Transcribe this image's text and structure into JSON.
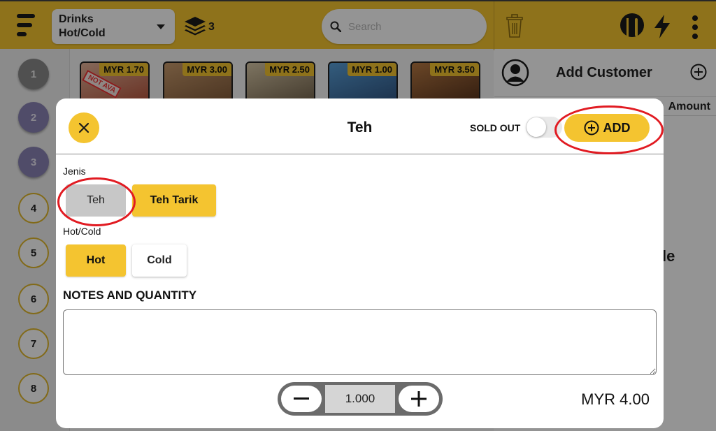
{
  "header": {
    "category_line1": "Drinks",
    "category_line2": "Hot/Cold",
    "layers_count": "3",
    "search_placeholder": "Search"
  },
  "tables": [
    "1",
    "2",
    "3",
    "4",
    "5",
    "6",
    "7",
    "8"
  ],
  "products": [
    {
      "price": "MYR 1.70",
      "badge": "NOT AVA"
    },
    {
      "price": "MYR 3.00"
    },
    {
      "price": "MYR 2.50"
    },
    {
      "price": "MYR 1.00"
    },
    {
      "price": "MYR 3.50"
    }
  ],
  "cart": {
    "add_customer": "Add Customer",
    "amount_header": "Amount",
    "partial_text": "le"
  },
  "modal": {
    "title": "Teh",
    "sold_out_label": "SOLD OUT",
    "add_label": "ADD",
    "groups": [
      {
        "label": "Jenis",
        "options": [
          "Teh",
          "Teh Tarik"
        ]
      },
      {
        "label": "Hot/Cold",
        "options": [
          "Hot",
          "Cold"
        ]
      }
    ],
    "notes_title": "NOTES AND QUANTITY",
    "quantity": "1.000",
    "total": "MYR 4.00"
  },
  "colors": {
    "accent": "#f4c430",
    "highlight": "#e11b22"
  }
}
